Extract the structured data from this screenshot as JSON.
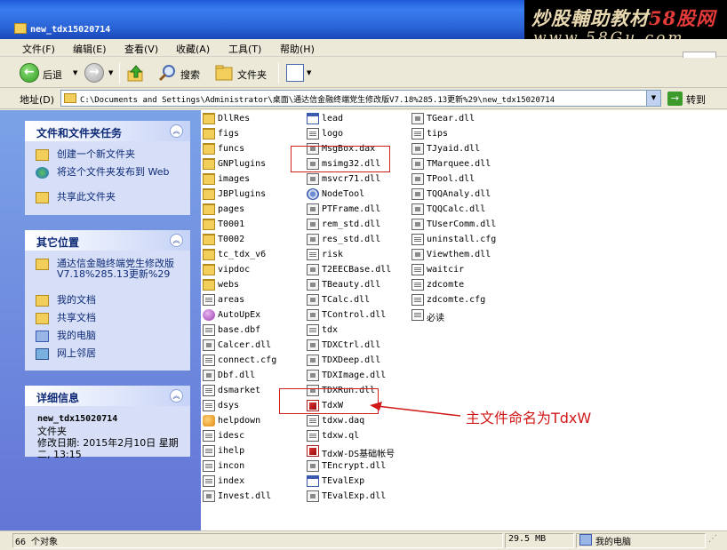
{
  "window": {
    "title": "new_tdx15020714"
  },
  "watermark": {
    "line1_main": "炒股輔助教材",
    "line1_red": "58股网",
    "line2": "www.58Gu.com"
  },
  "menu": [
    "文件(F)",
    "编辑(E)",
    "查看(V)",
    "收藏(A)",
    "工具(T)",
    "帮助(H)"
  ],
  "toolbar": {
    "back": "后退",
    "search": "搜索",
    "folders": "文件夹"
  },
  "address": {
    "label": "地址(D)",
    "path": "C:\\Documents and Settings\\Administrator\\桌面\\通达信金融终端党生修改版V7.18%285.13更新%29\\new_tdx15020714",
    "go": "转到"
  },
  "panels": {
    "tasks": {
      "title": "文件和文件夹任务",
      "items": [
        "创建一个新文件夹",
        "将这个文件夹发布到 Web",
        "共享此文件夹"
      ]
    },
    "places": {
      "title": "其它位置",
      "items": [
        "通达信金融终端党生修改版V7.18%285.13更新%29",
        "我的文档",
        "共享文档",
        "我的电脑",
        "网上邻居"
      ]
    },
    "details": {
      "title": "详细信息",
      "name": "new_tdx15020714",
      "type": "文件夹",
      "modified": "修改日期: 2015年2月10日 星期二, 13:15"
    }
  },
  "files": {
    "col1": [
      {
        "name": "DllRes",
        "icon": "folder"
      },
      {
        "name": "figs",
        "icon": "folder"
      },
      {
        "name": "funcs",
        "icon": "folder"
      },
      {
        "name": "GNPlugins",
        "icon": "folder"
      },
      {
        "name": "images",
        "icon": "folder"
      },
      {
        "name": "JBPlugins",
        "icon": "folder"
      },
      {
        "name": "pages",
        "icon": "folder"
      },
      {
        "name": "T0001",
        "icon": "folder"
      },
      {
        "name": "T0002",
        "icon": "folder"
      },
      {
        "name": "tc_tdx_v6",
        "icon": "folder"
      },
      {
        "name": "vipdoc",
        "icon": "folder"
      },
      {
        "name": "webs",
        "icon": "folder"
      },
      {
        "name": "areas",
        "icon": "doc"
      },
      {
        "name": "AutoUpEx",
        "icon": "orb"
      },
      {
        "name": "base.dbf",
        "icon": "doc"
      },
      {
        "name": "Calcer.dll",
        "icon": "dll"
      },
      {
        "name": "connect.cfg",
        "icon": "doc"
      },
      {
        "name": "Dbf.dll",
        "icon": "dll"
      },
      {
        "name": "dsmarket",
        "icon": "doc"
      },
      {
        "name": "dsys",
        "icon": "doc"
      },
      {
        "name": "helpdown",
        "icon": "dl"
      },
      {
        "name": "idesc",
        "icon": "doc"
      },
      {
        "name": "ihelp",
        "icon": "doc"
      },
      {
        "name": "incon",
        "icon": "doc"
      },
      {
        "name": "index",
        "icon": "doc"
      },
      {
        "name": "Invest.dll",
        "icon": "dll"
      }
    ],
    "col2": [
      {
        "name": "lead",
        "icon": "exe"
      },
      {
        "name": "logo",
        "icon": "doc"
      },
      {
        "name": "MsgBox.dax",
        "icon": "dll"
      },
      {
        "name": "msimg32.dll",
        "icon": "dll"
      },
      {
        "name": "msvcr71.dll",
        "icon": "dll"
      },
      {
        "name": "NodeTool",
        "icon": "gear"
      },
      {
        "name": "PTFrame.dll",
        "icon": "dll"
      },
      {
        "name": "rem_std.dll",
        "icon": "dll"
      },
      {
        "name": "res_std.dll",
        "icon": "dll"
      },
      {
        "name": "risk",
        "icon": "doc"
      },
      {
        "name": "T2EECBase.dll",
        "icon": "dll"
      },
      {
        "name": "TBeauty.dll",
        "icon": "dll"
      },
      {
        "name": "TCalc.dll",
        "icon": "dll"
      },
      {
        "name": "TControl.dll",
        "icon": "dll"
      },
      {
        "name": "tdx",
        "icon": "doc"
      },
      {
        "name": "TDXCtrl.dll",
        "icon": "dll"
      },
      {
        "name": "TDXDeep.dll",
        "icon": "dll"
      },
      {
        "name": "TDXImage.dll",
        "icon": "dll"
      },
      {
        "name": "TDXRun.dll",
        "icon": "dll"
      },
      {
        "name": "TdxW",
        "icon": "app"
      },
      {
        "name": "tdxw.daq",
        "icon": "doc"
      },
      {
        "name": "tdxw.ql",
        "icon": "doc"
      },
      {
        "name": "TdxW-DS基础帐号",
        "icon": "app"
      },
      {
        "name": "TEncrypt.dll",
        "icon": "dll"
      },
      {
        "name": "TEvalExp",
        "icon": "exe"
      },
      {
        "name": "TEvalExp.dll",
        "icon": "dll"
      }
    ],
    "col3": [
      {
        "name": "TGear.dll",
        "icon": "dll"
      },
      {
        "name": "tips",
        "icon": "doc"
      },
      {
        "name": "TJyaid.dll",
        "icon": "dll"
      },
      {
        "name": "TMarquee.dll",
        "icon": "dll"
      },
      {
        "name": "TPool.dll",
        "icon": "dll"
      },
      {
        "name": "TQQAnaly.dll",
        "icon": "dll"
      },
      {
        "name": "TQQCalc.dll",
        "icon": "dll"
      },
      {
        "name": "TUserComm.dll",
        "icon": "dll"
      },
      {
        "name": "uninstall.cfg",
        "icon": "doc"
      },
      {
        "name": "Viewthem.dll",
        "icon": "dll"
      },
      {
        "name": "waitcir",
        "icon": "doc"
      },
      {
        "name": "zdcomte",
        "icon": "doc"
      },
      {
        "name": "zdcomte.cfg",
        "icon": "doc"
      },
      {
        "name": "必读",
        "icon": "doc"
      }
    ]
  },
  "annotation": "主文件命名为TdxW",
  "status": {
    "count": "66 个对象",
    "size": "29.5 MB",
    "location": "我的电脑"
  }
}
